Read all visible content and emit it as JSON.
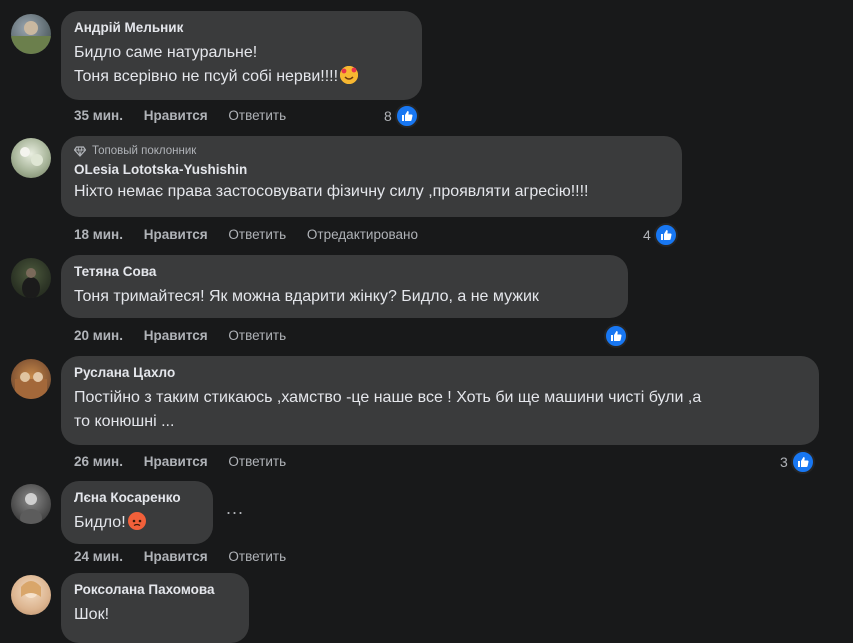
{
  "comments": [
    {
      "author": "Андрій Мельник",
      "lines": [
        "Бидло саме натуральне!",
        "Тоня всерівно не псуй собі нерви!!!!"
      ],
      "time": "35 мин.",
      "like_label": "Нравится",
      "reply_label": "Ответить",
      "reactions": "8"
    },
    {
      "badge": "Топовый поклонник",
      "author": "OLesia Lototska-Yushishin",
      "lines": [
        "Ніхто немає права застосовувати фізичну силу ,проявляти агресію!!!!"
      ],
      "time": "18 мин.",
      "like_label": "Нравится",
      "reply_label": "Ответить",
      "edited_label": "Отредактировано",
      "reactions": "4"
    },
    {
      "author": "Тетяна Сова",
      "lines": [
        "Тоня тримайтеся! Як можна вдарити жінку? Бидло, а не мужик"
      ],
      "time": "20 мин.",
      "like_label": "Нравится",
      "reply_label": "Ответить",
      "reactions": ""
    },
    {
      "author": "Руслана Цахло",
      "lines": [
        "Постійно з таким стикаюсь ,хамство -це наше все ! Хоть би ще машини чисті були ,а",
        "то конюшні ..."
      ],
      "time": "26 мин.",
      "like_label": "Нравится",
      "reply_label": "Ответить",
      "reactions": "3"
    },
    {
      "author": "Лєна Косаренко",
      "lines": [
        "Бидло!"
      ],
      "time": "24 мин.",
      "like_label": "Нравится",
      "reply_label": "Ответить",
      "more": "..."
    },
    {
      "author": "Роксолана Пахомова",
      "lines": [
        "Шок!"
      ]
    }
  ],
  "colors": {
    "background": "#18191a",
    "bubble": "#3a3b3c",
    "like_blue": "#1877f2"
  }
}
